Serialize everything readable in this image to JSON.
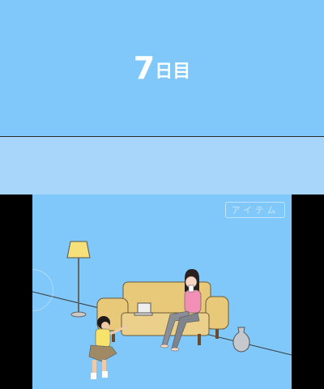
{
  "top_screen": {
    "day_number": "7",
    "day_suffix": "日目"
  },
  "scene": {
    "item_button_label": "アイテム",
    "icons": [
      "floor-lamp-icon",
      "sofa-icon",
      "laptop-icon",
      "vase-icon",
      "woman-character",
      "boy-character"
    ]
  },
  "colors": {
    "sky": "#80c8fa",
    "band": "#a8d6fb",
    "sofa": "#e8c97a",
    "shirt": "#f28fb5"
  }
}
